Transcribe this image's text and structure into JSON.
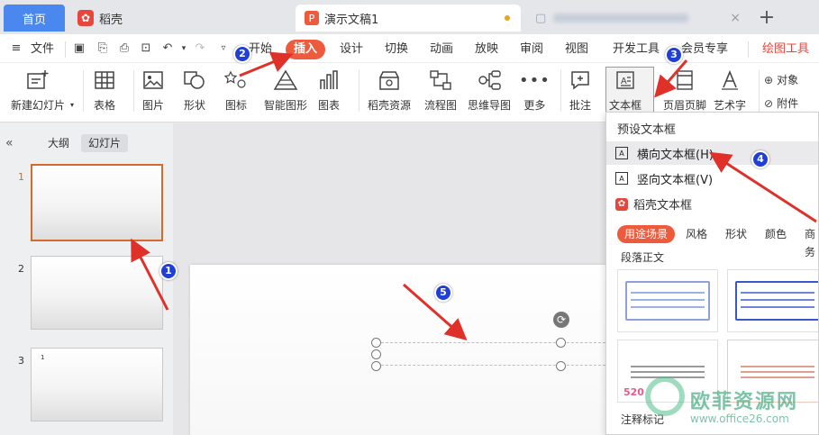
{
  "tabs": [
    {
      "label": "首页"
    },
    {
      "label": "稻壳"
    },
    {
      "label": "演示文稿1"
    }
  ],
  "menu": {
    "file": "文件",
    "items": [
      "开始",
      "插入",
      "设计",
      "切换",
      "动画",
      "放映",
      "审阅",
      "视图",
      "开发工具",
      "会员专享",
      "绘图工具"
    ],
    "active": "插入"
  },
  "ribbon": {
    "new_slide": "新建幻灯片",
    "table": "表格",
    "picture": "图片",
    "shape": "形状",
    "icon": "图标",
    "smart_art": "智能图形",
    "chart": "图表",
    "docer_resources": "稻壳资源",
    "flowchart": "流程图",
    "mindmap": "思维导图",
    "more": "更多",
    "comment": "批注",
    "textbox": "文本框",
    "header_footer": "页眉页脚",
    "wordart": "艺术字",
    "object": "对象",
    "attachment": "附件"
  },
  "left_panel": {
    "tab_outline": "大纲",
    "tab_slides": "幻灯片",
    "slide_numbers": [
      "1",
      "2",
      "3"
    ],
    "slide3_mark": "1"
  },
  "dropdown": {
    "preset_title": "预设文本框",
    "horizontal": "横向文本框(H)",
    "vertical": "竖向文本框(V)",
    "docer_title": "稻壳文本框",
    "chips": [
      "用途场景",
      "风格",
      "形状",
      "颜色",
      "商务"
    ],
    "paragraph": "段落正文",
    "note": "注释标记"
  },
  "annotations": [
    "1",
    "2",
    "3",
    "4",
    "5"
  ],
  "watermark": {
    "text": "欧菲资源网",
    "url": "www.office26.com"
  },
  "colors": {
    "accent": "#ee5b3c",
    "home_tab": "#4a88f0",
    "arrow": "#e0302a",
    "badge": "#1f3fd6"
  }
}
